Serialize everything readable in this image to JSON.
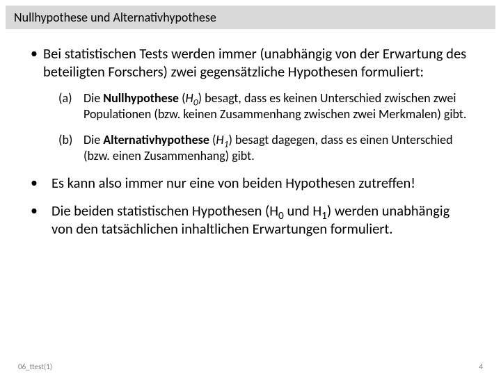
{
  "title": "Nullhypothese und Alternativhypothese",
  "bullets": {
    "b1": "Bei statistischen Tests werden immer (unabhängig von der Erwartung des beteiligten Forschers) zwei gegensätzliche Hypothesen formuliert:",
    "a_marker": "(a)",
    "a_pre": "Die ",
    "a_bold": "Nullhypothese",
    "a_post": " (",
    "a_sym": "H",
    "a_sub": "0",
    "a_tail": ") besagt, dass es keinen Unterschied zwischen zwei Populationen (bzw. keinen Zusammenhang zwischen zwei Merkmalen) gibt.",
    "b_marker": "(b)",
    "b_pre": "Die ",
    "b_bold": "Alternativhypothese",
    "b_post": " (",
    "b_sym": "H",
    "b_sub": "1",
    "b_tail": ") besagt dagegen, dass es einen Unterschied (bzw. einen Zusammenhang) gibt.",
    "b2": "Es kann also immer nur eine von beiden Hypothesen zutreffen!",
    "b3_pre": "Die beiden statistischen Hypothesen (H",
    "b3_sub0": "0",
    "b3_mid": " und H",
    "b3_sub1": "1",
    "b3_tail": ") werden unabhängig von den tatsächlichen inhaltlichen Erwartungen formuliert."
  },
  "footer": {
    "left": "06_ttest(1)",
    "right": "4"
  }
}
